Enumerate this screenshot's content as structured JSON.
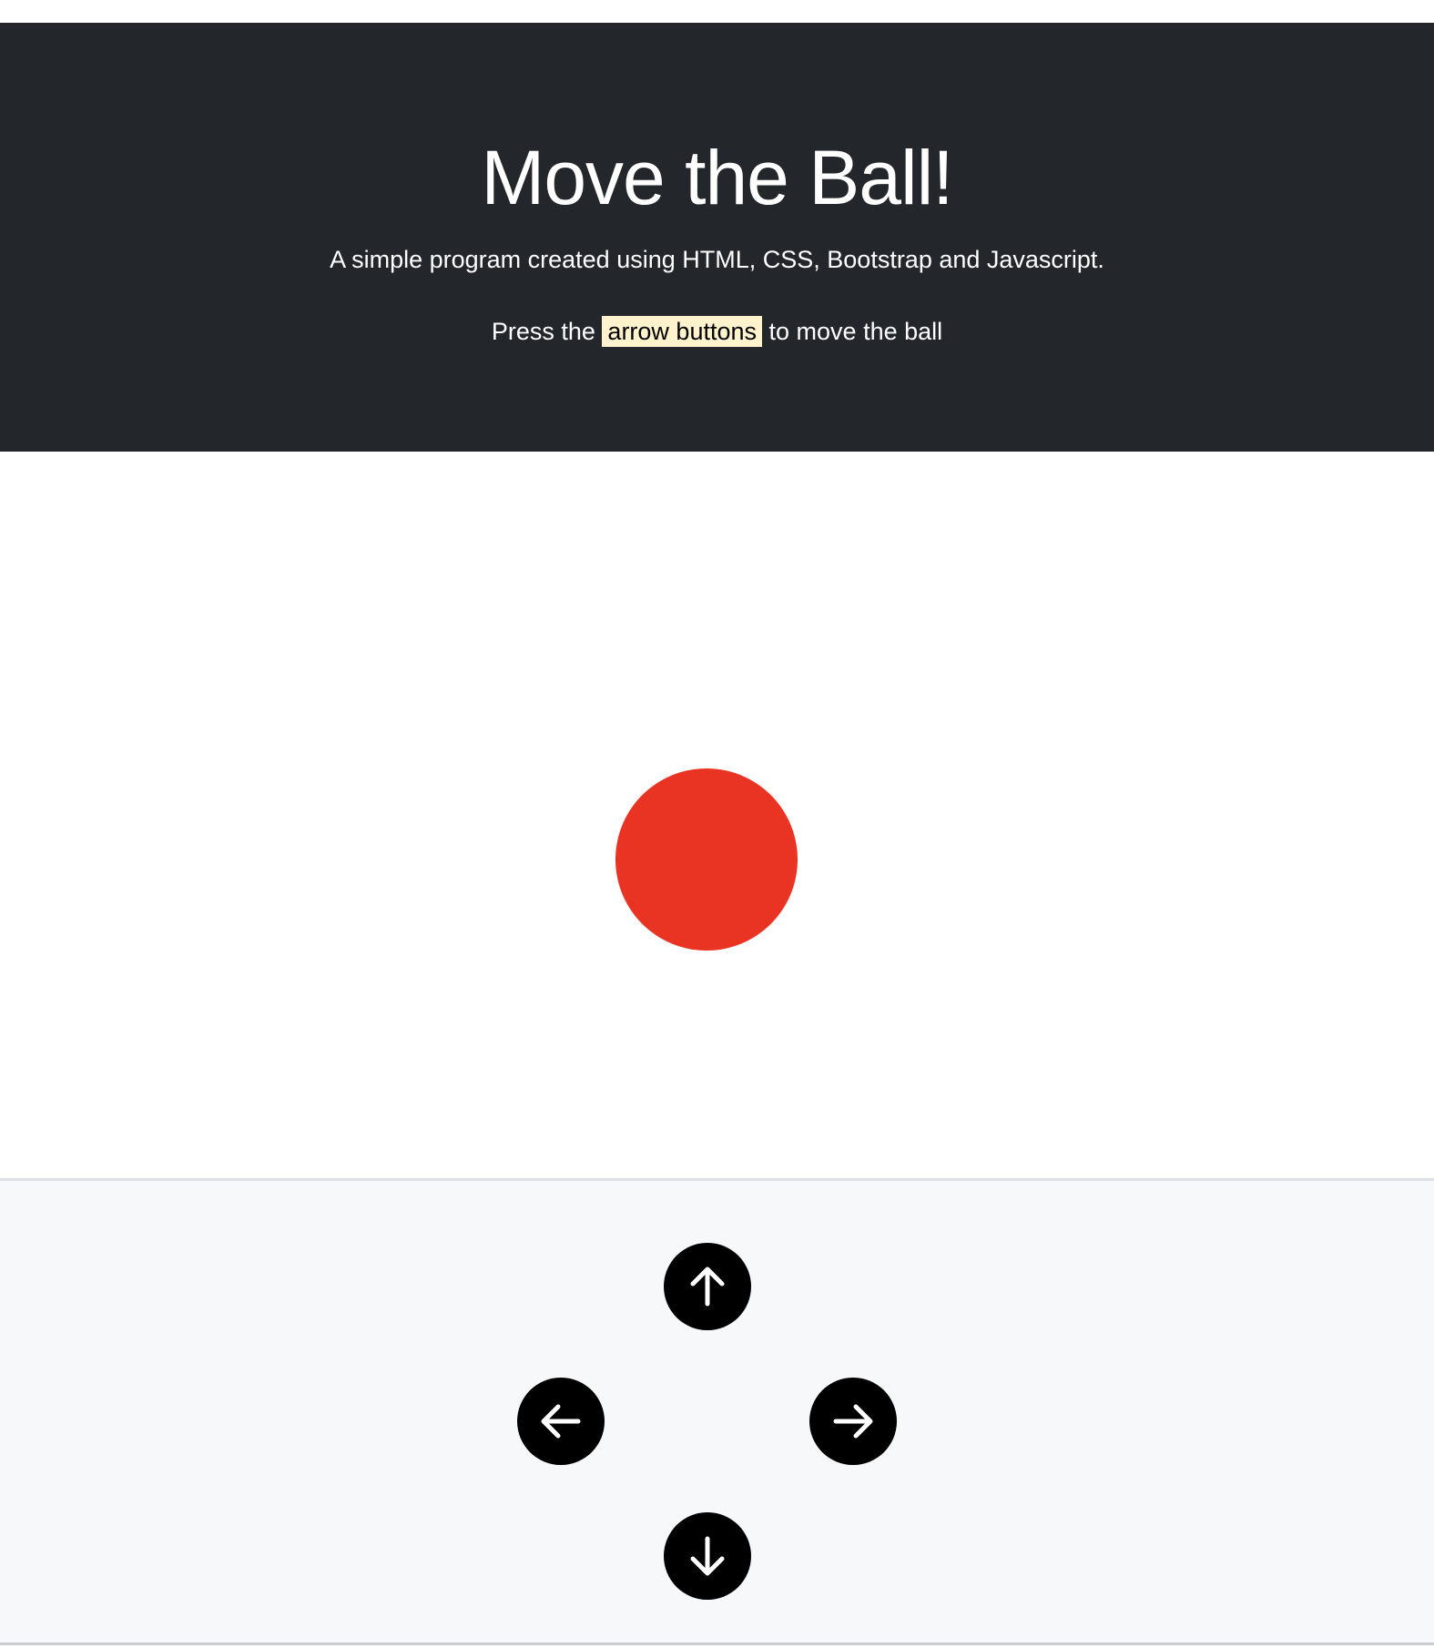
{
  "header": {
    "title": "Move the Ball!",
    "subtitle": "A simple program created using HTML, CSS, Bootstrap and Javascript.",
    "instruction_prefix": "Press the",
    "instruction_highlight": "arrow buttons",
    "instruction_suffix": "to move the ball"
  },
  "ball": {
    "color": "#e93424"
  },
  "controls": {
    "buttons": [
      {
        "direction": "up",
        "icon": "arrow-up-icon"
      },
      {
        "direction": "left",
        "icon": "arrow-left-icon"
      },
      {
        "direction": "right",
        "icon": "arrow-right-icon"
      },
      {
        "direction": "down",
        "icon": "arrow-down-icon"
      }
    ]
  },
  "colors": {
    "header_bg": "#23262b",
    "highlight_bg": "#fff3cd",
    "controls_bg": "#f7f8fa",
    "button_bg": "#000000"
  }
}
